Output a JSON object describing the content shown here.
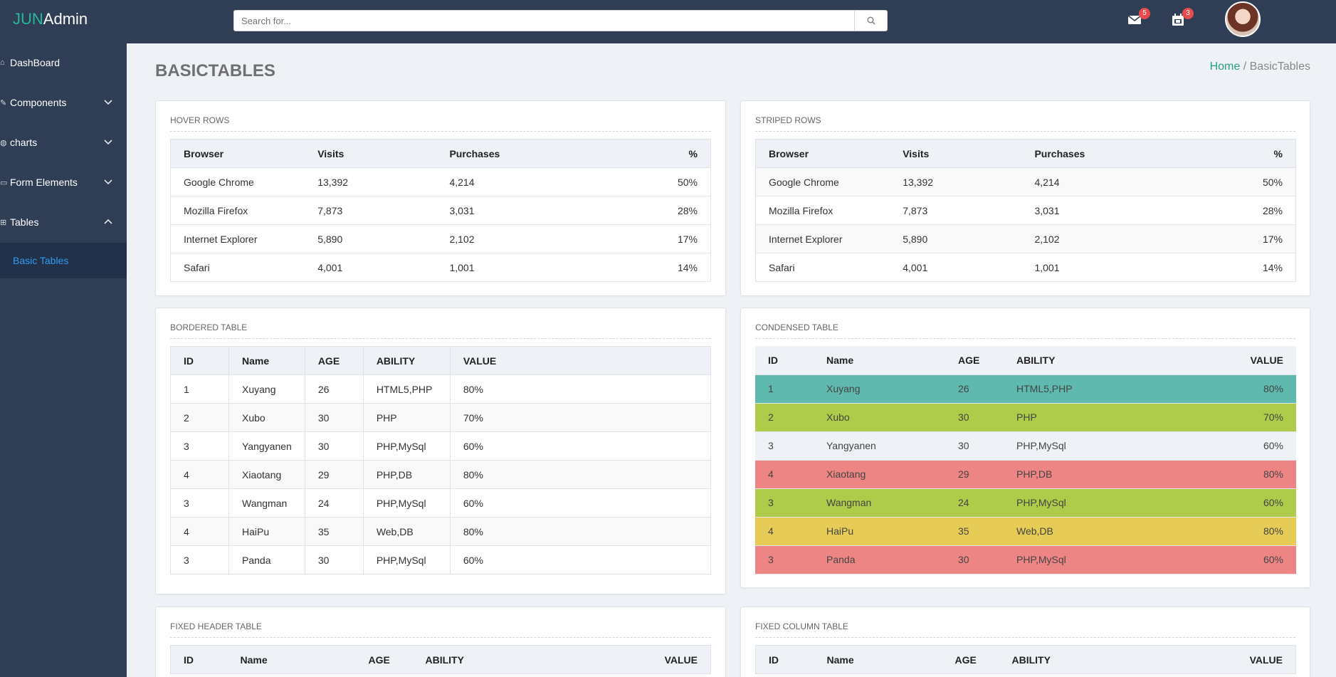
{
  "app": {
    "logo_prefix": "JUN",
    "logo_suffix": "Admin"
  },
  "search": {
    "placeholder": "Search for..."
  },
  "notifications": {
    "mail_count": "5",
    "calendar_count": "3"
  },
  "sidebar": {
    "items": [
      {
        "label": "DashBoard",
        "icon": "home-icon",
        "expanded": null
      },
      {
        "label": "Components",
        "icon": "puzzle-icon",
        "expanded": false
      },
      {
        "label": "charts",
        "icon": "globe-icon",
        "expanded": false
      },
      {
        "label": "Form Elements",
        "icon": "form-icon",
        "expanded": false
      },
      {
        "label": "Tables",
        "icon": "table-icon",
        "expanded": true
      }
    ],
    "active_sub": "Basic Tables"
  },
  "page": {
    "title": "BASICTABLES",
    "breadcrumb_home": "Home",
    "breadcrumb_sep": "/",
    "breadcrumb_current": "BasicTables"
  },
  "browser_table": {
    "headers": [
      "Browser",
      "Visits",
      "Purchases",
      "%"
    ],
    "rows": [
      [
        "Google Chrome",
        "13,392",
        "4,214",
        "50%"
      ],
      [
        "Mozilla Firefox",
        "7,873",
        "3,031",
        "28%"
      ],
      [
        "Internet Explorer",
        "5,890",
        "2,102",
        "17%"
      ],
      [
        "Safari",
        "4,001",
        "1,001",
        "14%"
      ]
    ]
  },
  "panels": {
    "hover": "HOVER ROWS",
    "striped": "STRIPED ROWS",
    "bordered": "BORDERED TABLE",
    "condensed": "CONDENSED TABLE",
    "fixed_header": "FIXED HEADER TABLE",
    "fixed_column": "FIXED COLUMN TABLE"
  },
  "people_headers": [
    "ID",
    "Name",
    "AGE",
    "ABILITY",
    "VALUE"
  ],
  "bordered_rows": [
    [
      "1",
      "Xuyang",
      "26",
      "HTML5,PHP",
      "80%"
    ],
    [
      "2",
      "Xubo",
      "30",
      "PHP",
      "70%"
    ],
    [
      "3",
      "Yangyanen",
      "30",
      "PHP,MySql",
      "60%"
    ],
    [
      "4",
      "Xiaotang",
      "29",
      "PHP,DB",
      "80%"
    ],
    [
      "3",
      "Wangman",
      "24",
      "PHP,MySql",
      "60%"
    ],
    [
      "4",
      "HaiPu",
      "35",
      "Web,DB",
      "80%"
    ],
    [
      "3",
      "Panda",
      "30",
      "PHP,MySql",
      "60%"
    ]
  ],
  "condensed_rows": [
    {
      "cells": [
        "1",
        "Xuyang",
        "26",
        "HTML5,PHP",
        "80%"
      ],
      "color": "#5fb9ae"
    },
    {
      "cells": [
        "2",
        "Xubo",
        "30",
        "PHP",
        "70%"
      ],
      "color": "#afcb4a"
    },
    {
      "cells": [
        "3",
        "Yangyanen",
        "30",
        "PHP,MySql",
        "60%"
      ],
      "color": "#eef1f5"
    },
    {
      "cells": [
        "4",
        "Xiaotang",
        "29",
        "PHP,DB",
        "80%"
      ],
      "color": "#ee8585"
    },
    {
      "cells": [
        "3",
        "Wangman",
        "24",
        "PHP,MySql",
        "60%"
      ],
      "color": "#afcb4a"
    },
    {
      "cells": [
        "4",
        "HaiPu",
        "35",
        "Web,DB",
        "80%"
      ],
      "color": "#e6cc56"
    },
    {
      "cells": [
        "3",
        "Panda",
        "30",
        "PHP,MySql",
        "60%"
      ],
      "color": "#ee8585"
    }
  ],
  "colors": {
    "topbar": "#2f3e54",
    "accent": "#29b89b",
    "active_link": "#2f9cf0",
    "badge": "#e84c4c"
  }
}
